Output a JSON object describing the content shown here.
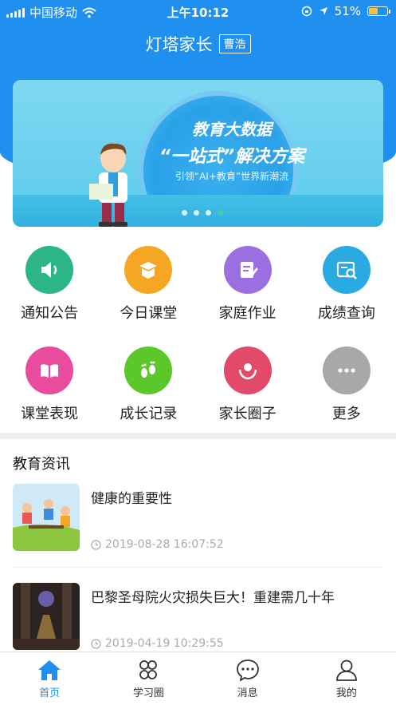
{
  "status_bar": {
    "carrier": "中国移动",
    "time": "上午10:12",
    "battery": "51%"
  },
  "nav": {
    "title": "灯塔家长",
    "user_badge": "曹浩"
  },
  "banner": {
    "headline": "教育大数据",
    "headline2": "“一站式”解决方案",
    "subline": "引领“AI+教育”世界新潮流",
    "active_dot": 3,
    "dot_count": 4
  },
  "grid": [
    {
      "label": "通知公告",
      "icon": "speaker-icon",
      "color": "#2db58a"
    },
    {
      "label": "今日课堂",
      "icon": "book-open-icon",
      "color": "#f5a623"
    },
    {
      "label": "家庭作业",
      "icon": "edit-icon",
      "color": "#9b6fe0"
    },
    {
      "label": "成绩查询",
      "icon": "search-doc-icon",
      "color": "#2aaae2"
    },
    {
      "label": "课堂表现",
      "icon": "book-icon",
      "color": "#e94c9e"
    },
    {
      "label": "成长记录",
      "icon": "footprint-icon",
      "color": "#5cc72a"
    },
    {
      "label": "家长圈子",
      "icon": "hands-heart-icon",
      "color": "#e24a6a"
    },
    {
      "label": "更多",
      "icon": "more-icon",
      "color": "#a8a8a8"
    }
  ],
  "section": {
    "title": "教育资讯"
  },
  "news": [
    {
      "title": "健康的重要性",
      "time": "2019-08-28 16:07:52"
    },
    {
      "title": "巴黎圣母院火灾损失巨大！重建需几十年",
      "time": "2019-04-19 10:29:55"
    }
  ],
  "tabbar": [
    {
      "label": "首页",
      "icon": "home-icon",
      "active": true
    },
    {
      "label": "学习圈",
      "icon": "clover-icon",
      "active": false
    },
    {
      "label": "消息",
      "icon": "message-icon",
      "active": false
    },
    {
      "label": "我的",
      "icon": "user-icon",
      "active": false
    }
  ],
  "colors": {
    "primary": "#1f8ff0",
    "divider": "#f0f0f3"
  }
}
